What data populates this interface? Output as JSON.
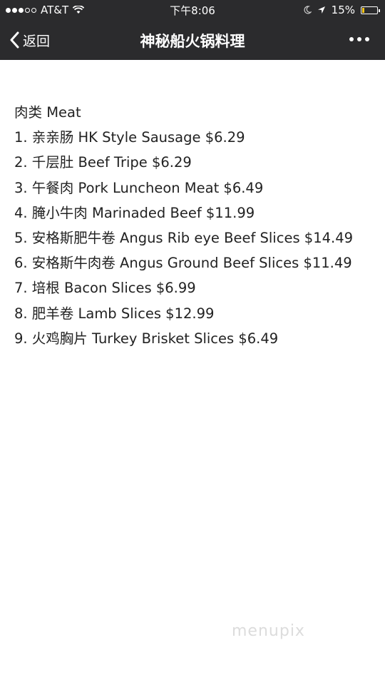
{
  "status_bar": {
    "carrier": "AT&T",
    "time": "下午8:06",
    "battery_percent_text": "15%",
    "battery_level": 0.15,
    "signal_icon": "signal-dots-icon",
    "wifi_icon": "wifi-icon",
    "moon_icon": "moon-icon",
    "location_icon": "location-arrow-icon",
    "battery_icon": "battery-icon",
    "battery_color": "#f5c518"
  },
  "nav": {
    "back_label": "返回",
    "title": "神秘船火锅料理",
    "back_icon": "chevron-left-icon",
    "more_icon": "more-dots-icon",
    "bar_color": "#2b2b2d"
  },
  "menu": {
    "heading": "肉类 Meat",
    "items": [
      "1. 亲亲肠 HK Style Sausage $6.29",
      "2. 千层肚 Beef Tripe $6.29",
      "3. 午餐肉 Pork Luncheon Meat $6.49",
      "4. 腌小牛肉 Marinaded Beef $11.99",
      "5. 安格斯肥牛卷 Angus Rib eye Beef Slices $14.49",
      "6. 安格斯牛肉卷 Angus Ground Beef Slices $11.49",
      "7. 培根 Bacon Slices $6.99",
      "8. 肥羊卷 Lamb Slices $12.99",
      "9. 火鸡胸片 Turkey Brisket Slices $6.49"
    ]
  },
  "watermark": "menupix"
}
